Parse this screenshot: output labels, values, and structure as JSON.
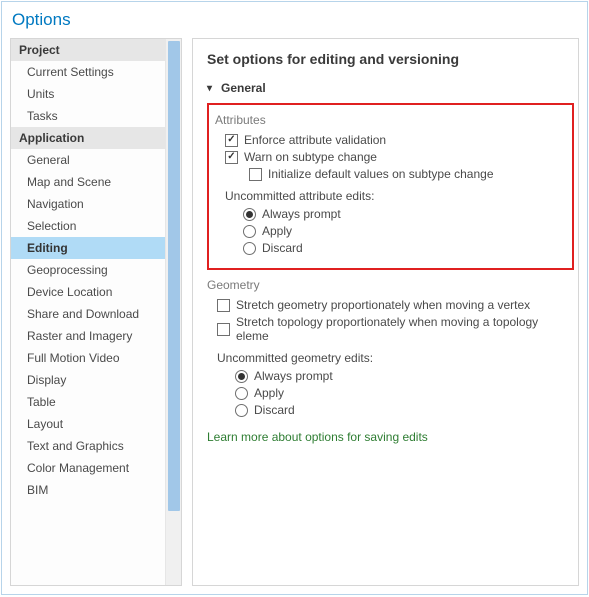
{
  "title": "Options",
  "sidebar": {
    "categories": [
      {
        "label": "Project",
        "items": [
          "Current Settings",
          "Units",
          "Tasks"
        ]
      },
      {
        "label": "Application",
        "items": [
          "General",
          "Map and Scene",
          "Navigation",
          "Selection",
          "Editing",
          "Geoprocessing",
          "Device Location",
          "Share and Download",
          "Raster and Imagery",
          "Full Motion Video",
          "Display",
          "Table",
          "Layout",
          "Text and Graphics",
          "Color Management",
          "BIM"
        ]
      }
    ],
    "selected": "Editing"
  },
  "content": {
    "heading": "Set options for editing and versioning",
    "group": "General",
    "attributes": {
      "title": "Attributes",
      "enforce": {
        "label": "Enforce attribute validation",
        "checked": true
      },
      "warnSubtype": {
        "label": "Warn on subtype change",
        "checked": true
      },
      "initDefaults": {
        "label": "Initialize default values on subtype change",
        "checked": false
      },
      "uncommittedLabel": "Uncommitted attribute edits:",
      "uncommitted": {
        "options": [
          "Always prompt",
          "Apply",
          "Discard"
        ],
        "selected": "Always prompt"
      }
    },
    "geometry": {
      "title": "Geometry",
      "stretchVertex": {
        "label": "Stretch geometry proportionately when moving a vertex",
        "checked": false
      },
      "stretchTopo": {
        "label": "Stretch topology proportionately when moving a topology eleme",
        "checked": false
      },
      "uncommittedLabel": "Uncommitted geometry edits:",
      "uncommitted": {
        "options": [
          "Always prompt",
          "Apply",
          "Discard"
        ],
        "selected": "Always prompt"
      }
    },
    "learnMore": "Learn more about options for saving edits"
  }
}
